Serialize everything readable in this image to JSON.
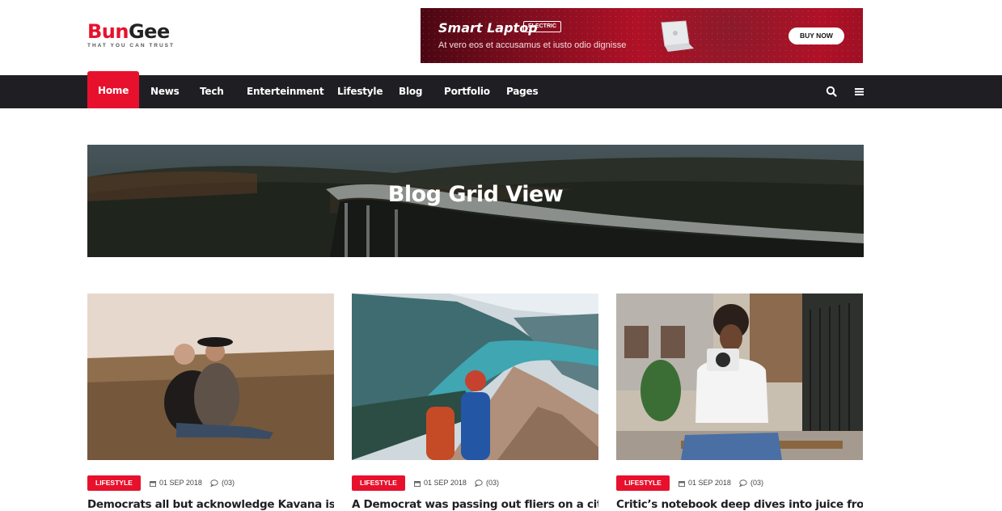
{
  "logo": {
    "part1": "Bun",
    "part2": "Gee",
    "tagline": "THAT YOU CAN TRUST"
  },
  "ad": {
    "title": "Smart Laptop",
    "badge": "ELECTRIC",
    "subtitle": "At vero eos et accusamus et iusto odio dignisse",
    "button": "BUY NOW"
  },
  "nav": {
    "items": [
      "Home",
      "News",
      "Tech",
      "Enterteinment",
      "Lifestyle",
      "Blog",
      "Portfolio",
      "Pages"
    ],
    "active": "Home",
    "icons": [
      "search-icon",
      "menu-icon"
    ]
  },
  "hero": {
    "title": "Blog Grid View"
  },
  "cards": [
    {
      "category": "LIFESTYLE",
      "date": "01 SEP 2018",
      "comments": "(03)",
      "title": "Democrats all but acknowledge Kavana is"
    },
    {
      "category": "LIFESTYLE",
      "date": "01 SEP 2018",
      "comments": "(03)",
      "title": "A Democrat was passing out fliers on a city"
    },
    {
      "category": "LIFESTYLE",
      "date": "01 SEP 2018",
      "comments": "(03)",
      "title": "Critic’s notebook deep dives into juice from"
    }
  ],
  "colors": {
    "accent": "#e8112d",
    "nav_bg": "#1f1f23"
  }
}
